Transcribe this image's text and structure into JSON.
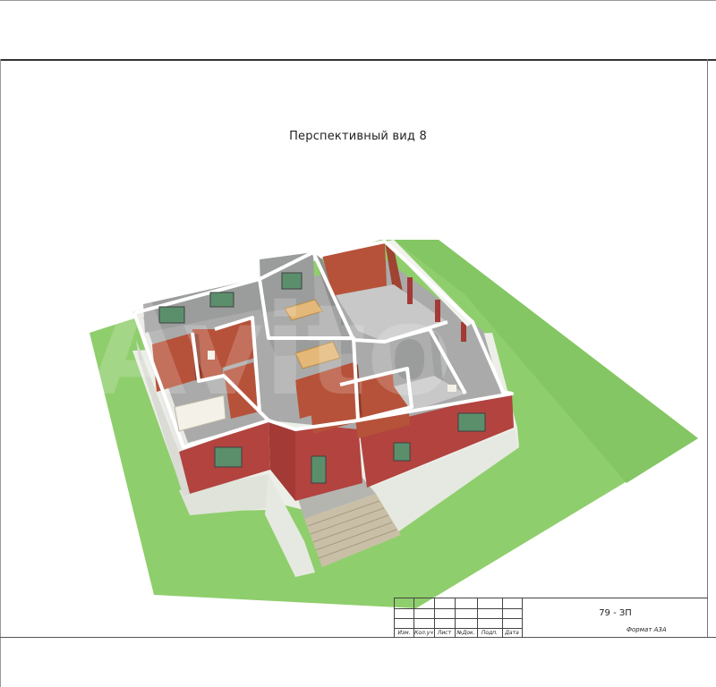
{
  "sheet": {
    "title": "Перспективный вид 8",
    "document_code": "79 - ЗП",
    "format_label": "Формат А3А",
    "stamp_columns": [
      "Изм.",
      "Кол.уч",
      "Лист",
      "№Док.",
      "Подп.",
      "Дата"
    ]
  },
  "watermark": {
    "text": "Avito"
  },
  "colors": {
    "lawn": "#8fce6c",
    "lawn_dark": "#6fb44e",
    "brick": "#b2433f",
    "brick_dark": "#8e2f2c",
    "floor": "#a9aaa9",
    "wall_top": "#ffffff",
    "interior_wall": "#b6523a",
    "block_wall": "#9b9d9c"
  }
}
